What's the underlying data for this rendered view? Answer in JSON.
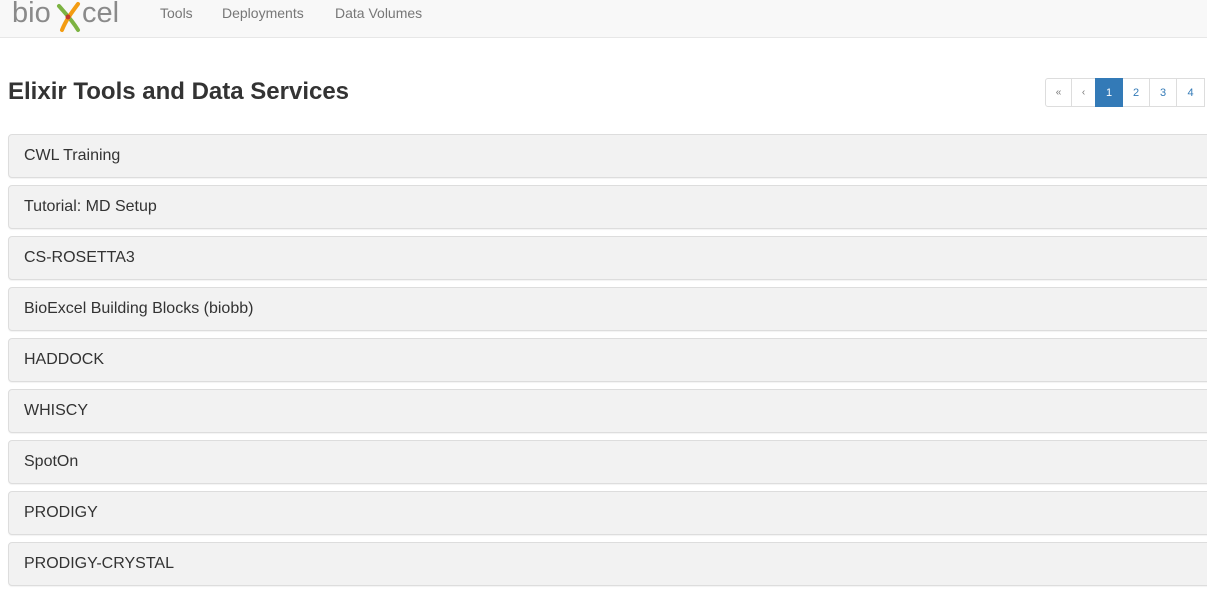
{
  "navbar": {
    "logo_text": "bioexcel",
    "links": [
      "Tools",
      "Deployments",
      "Data Volumes"
    ]
  },
  "page": {
    "title": "Elixir Tools and Data Services"
  },
  "pagination": {
    "first": "«",
    "prev": "‹",
    "pages": [
      "1",
      "2",
      "3",
      "4"
    ],
    "active_page": "1"
  },
  "tools": [
    "CWL Training",
    "Tutorial: MD Setup",
    "CS-ROSETTA3",
    "BioExcel Building Blocks (biobb)",
    "HADDOCK",
    "WHISCY",
    "SpotOn",
    "PRODIGY",
    "PRODIGY-CRYSTAL"
  ],
  "colors": {
    "accent": "#337ab7",
    "navbar_bg": "#f8f8f8",
    "panel_bg": "#f2f2f2",
    "logo_gray": "#8a8a8a",
    "logo_green": "#7cb342",
    "logo_orange": "#f39c12"
  }
}
